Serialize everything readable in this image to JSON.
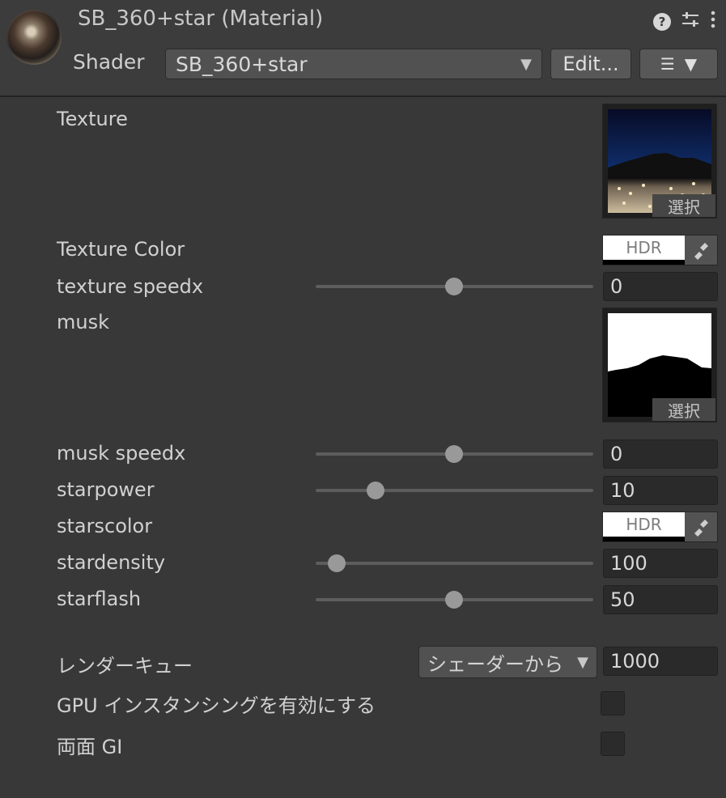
{
  "header": {
    "title": "SB_360+star (Material)",
    "icons": [
      "help-icon",
      "preset-icon",
      "more-vert-icon"
    ],
    "shader_label": "Shader",
    "shader_value": "SB_360+star",
    "edit_label": "Edit..."
  },
  "properties": {
    "texture_label": "Texture",
    "texture_select": "選択",
    "texture_color_label": "Texture Color",
    "texture_color_hdr": "HDR",
    "texture_speedx_label": "texture speedx",
    "texture_speedx_value": "0",
    "musk_label": "musk",
    "musk_select": "選択",
    "musk_speedx_label": "musk speedx",
    "musk_speedx_value": "0",
    "starpower_label": "starpower",
    "starpower_value": "10",
    "starscolor_label": "starscolor",
    "starscolor_hdr": "HDR",
    "stardensity_label": "stardensity",
    "stardensity_value": "100",
    "starflash_label": "starflash",
    "starflash_value": "50"
  },
  "advanced": {
    "render_queue_label": "レンダーキュー",
    "render_queue_mode": "シェーダーから",
    "render_queue_value": "1000",
    "gpu_instancing_label": "GPU インスタンシングを有効にする",
    "double_sided_gi_label": "両面 GI"
  }
}
